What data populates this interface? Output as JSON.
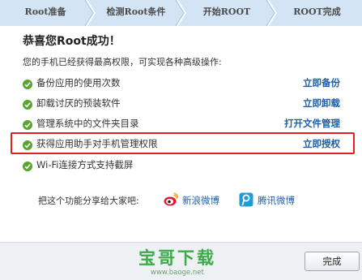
{
  "steps": [
    "Root准备",
    "检测Root条件",
    "开始ROOT",
    "ROOT完成"
  ],
  "title": "恭喜您Root成功！",
  "subtitle": "您的手机已经获得最高权限，可实现各种高级操作:",
  "features": [
    {
      "label": "备份应用的使用次数",
      "action": "立即备份"
    },
    {
      "label": "卸载讨厌的预装软件",
      "action": "立即卸载"
    },
    {
      "label": "管理系统中的文件夹目录",
      "action": "打开文件管理"
    },
    {
      "label": "获得应用助手对手机管理权限",
      "action": "立即授权"
    },
    {
      "label": "Wi-Fi连接方式支持截屏",
      "action": ""
    }
  ],
  "share": {
    "label": "把这个功能分享给大家吧:",
    "weibo": "新浪微博",
    "tencent": "腾讯微博"
  },
  "footer": {
    "done": "完成",
    "watermark_cn": "宝哥下载",
    "watermark_url": "www.baoge.net"
  },
  "colors": {
    "step_bar": "#d3e4f4",
    "check_green": "#5aa532",
    "link_blue": "#1c5fa8",
    "highlight_red": "#e41e1e"
  },
  "icons": {
    "check": "check-icon",
    "weibo": "sina-weibo-icon",
    "tencent": "tencent-weibo-icon"
  }
}
